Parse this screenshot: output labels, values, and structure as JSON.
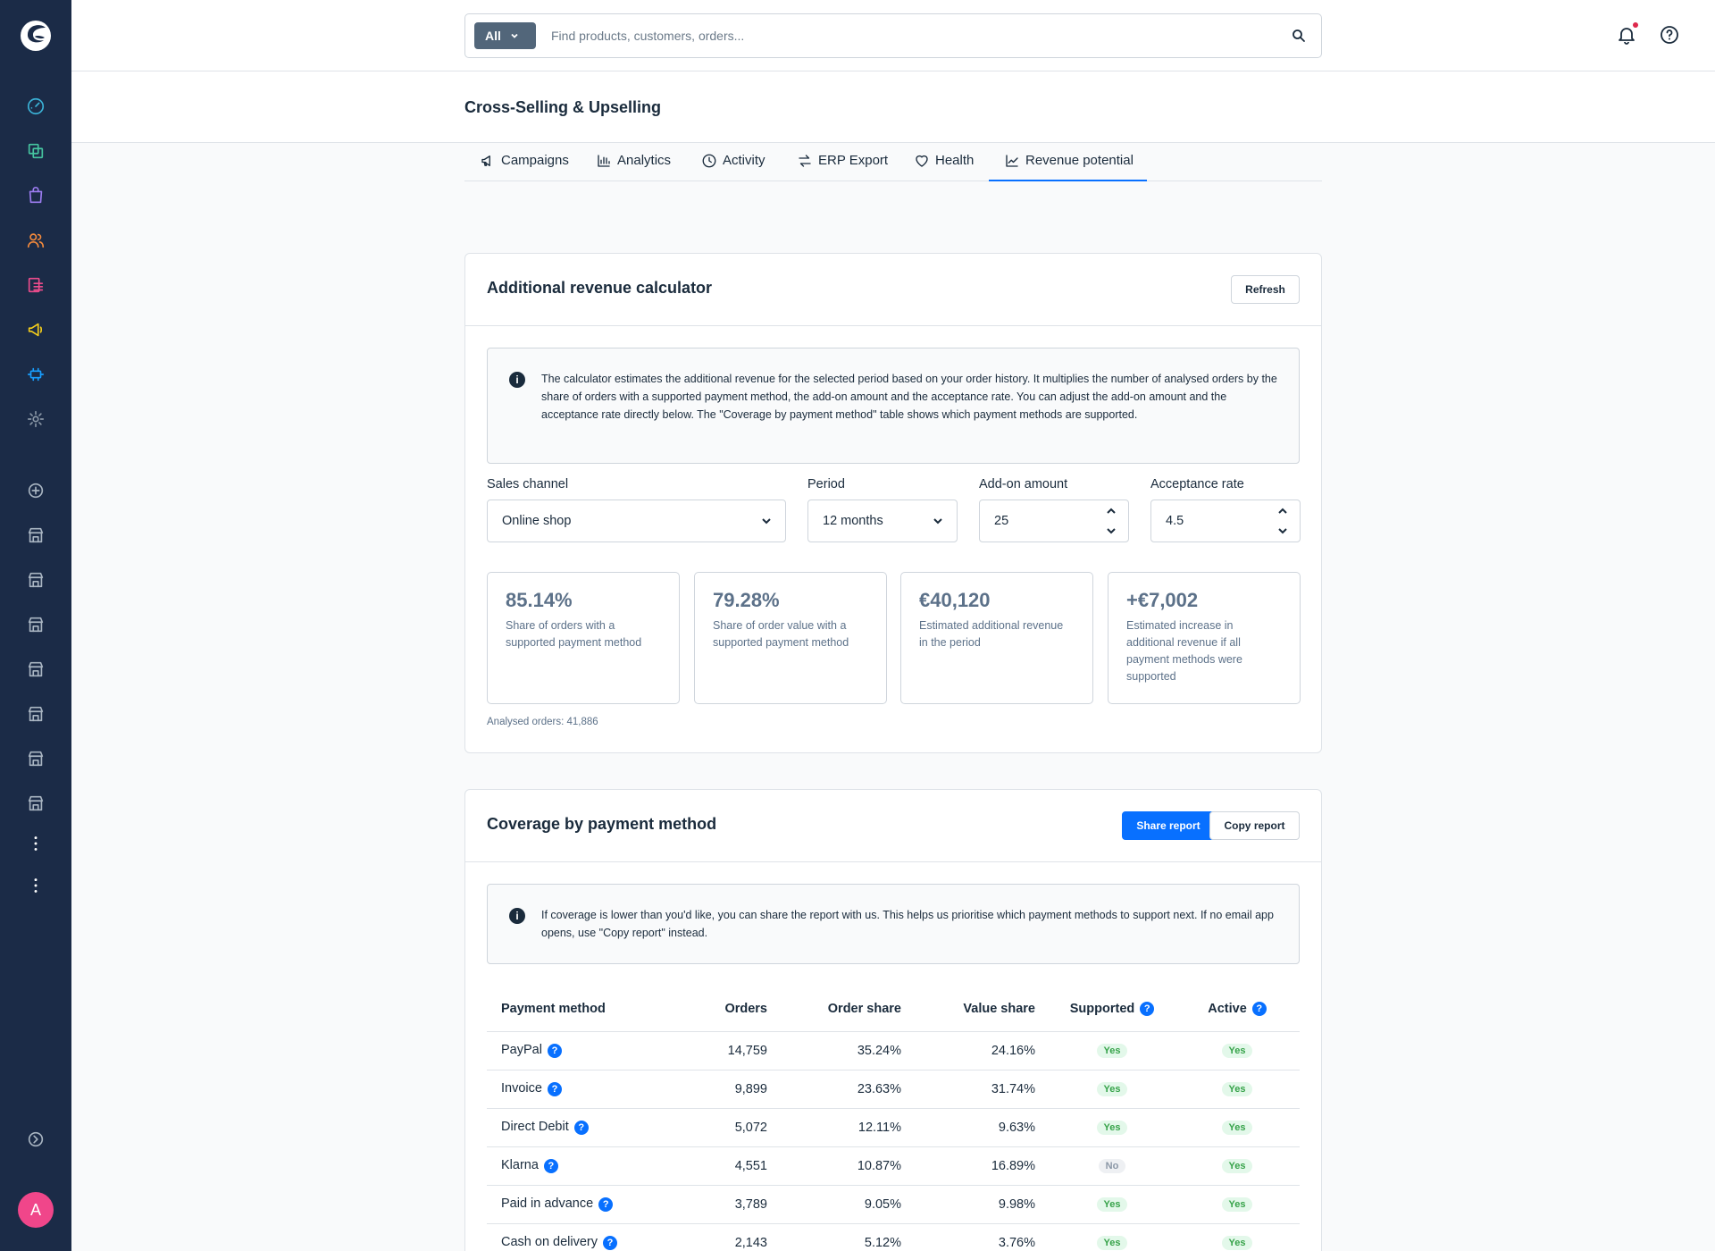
{
  "search": {
    "scope_label": "All",
    "placeholder": "Find products, customers, orders..."
  },
  "page": {
    "title": "Cross-Selling & Upselling"
  },
  "tabs": [
    {
      "label": "Campaigns",
      "icon": "megaphone-icon"
    },
    {
      "label": "Analytics",
      "icon": "bar-chart-icon"
    },
    {
      "label": "Activity",
      "icon": "clock-icon"
    },
    {
      "label": "ERP Export",
      "icon": "arrows-exchange-icon"
    },
    {
      "label": "Health",
      "icon": "heart-icon"
    },
    {
      "label": "Revenue potential",
      "icon": "trend-line-icon",
      "active": true
    }
  ],
  "calculator": {
    "title": "Additional revenue calculator",
    "refresh_label": "Refresh",
    "info": "The calculator estimates the additional revenue for the selected period based on your order history. It multiplies the number of analysed orders by the share of orders with a supported payment method, the add-on amount and the acceptance rate. You can adjust the add-on amount and the acceptance rate directly below. The \"Coverage by payment method\" table shows which payment methods are supported.",
    "fields": {
      "sales_channel_label": "Sales channel",
      "sales_channel_value": "Online shop",
      "period_label": "Period",
      "period_value": "12 months",
      "addon_label": "Add-on amount",
      "addon_value": "25",
      "acceptance_label": "Acceptance rate",
      "acceptance_value": "4.5"
    },
    "stats": [
      {
        "value": "85.14%",
        "label": "Share of orders with a supported payment method"
      },
      {
        "value": "79.28%",
        "label": "Share of order value with a supported payment method"
      },
      {
        "value": "€40,120",
        "label": "Estimated additional revenue in the period"
      },
      {
        "value": "+€7,002",
        "label": "Estimated increase in additional revenue if all payment methods were supported"
      }
    ],
    "analysed_orders": "Analysed orders: 41,886"
  },
  "coverage": {
    "title": "Coverage by payment method",
    "share_label": "Share report",
    "copy_label": "Copy report",
    "info": "If coverage is lower than you'd like, you can share the report with us. This helps us prioritise which payment methods to support next. If no email app opens, use \"Copy report\" instead.",
    "columns": [
      "Payment method",
      "Orders",
      "Order share",
      "Value share",
      "Supported",
      "Active"
    ],
    "rows": [
      {
        "method": "PayPal",
        "orders": "14,759",
        "order_share": "35.24%",
        "value_share": "24.16%",
        "supported": "Yes",
        "active": "Yes"
      },
      {
        "method": "Invoice",
        "orders": "9,899",
        "order_share": "23.63%",
        "value_share": "31.74%",
        "supported": "Yes",
        "active": "Yes"
      },
      {
        "method": "Direct Debit",
        "orders": "5,072",
        "order_share": "12.11%",
        "value_share": "9.63%",
        "supported": "Yes",
        "active": "Yes"
      },
      {
        "method": "Klarna",
        "orders": "4,551",
        "order_share": "10.87%",
        "value_share": "16.89%",
        "supported": "No",
        "active": "Yes"
      },
      {
        "method": "Paid in advance",
        "orders": "3,789",
        "order_share": "9.05%",
        "value_share": "9.98%",
        "supported": "Yes",
        "active": "Yes"
      },
      {
        "method": "Cash on delivery",
        "orders": "2,143",
        "order_share": "5.12%",
        "value_share": "3.76%",
        "supported": "Yes",
        "active": "Yes"
      }
    ]
  },
  "user": {
    "avatar_initial": "A"
  },
  "colors": {
    "sidebar": "#1b2b47",
    "accent": "#0870ff",
    "yes": "#37a34a",
    "no": "#8a97a6",
    "notification_dot": "#de294c"
  }
}
